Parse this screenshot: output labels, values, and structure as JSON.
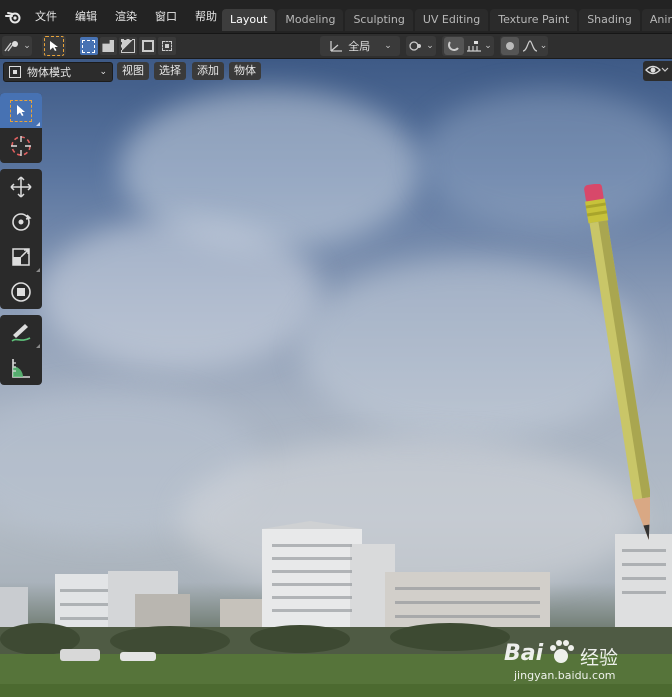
{
  "menu": {
    "items": [
      "文件",
      "编辑",
      "渲染",
      "窗口",
      "帮助"
    ]
  },
  "workspaces": {
    "tabs": [
      {
        "label": "Layout",
        "active": true
      },
      {
        "label": "Modeling",
        "active": false
      },
      {
        "label": "Sculpting",
        "active": false
      },
      {
        "label": "UV Editing",
        "active": false
      },
      {
        "label": "Texture Paint",
        "active": false
      },
      {
        "label": "Shading",
        "active": false
      },
      {
        "label": "Animatio",
        "active": false
      }
    ]
  },
  "tool_header": {
    "orientation_label": "全局"
  },
  "viewport_header": {
    "mode_label": "物体模式",
    "menu_buttons": [
      "视图",
      "选择",
      "添加",
      "物体"
    ]
  },
  "toolbar": {
    "tools": [
      {
        "name": "select-box-tool",
        "active": true
      },
      {
        "name": "cursor-tool",
        "active": false
      },
      {
        "name": "move-tool",
        "active": false
      },
      {
        "name": "rotate-tool",
        "active": false
      },
      {
        "name": "scale-tool",
        "active": false
      },
      {
        "name": "transform-tool",
        "active": false
      },
      {
        "name": "annotate-tool",
        "active": false
      },
      {
        "name": "measure-tool",
        "active": false
      }
    ]
  },
  "watermark": {
    "brand_left": "Bai",
    "brand_right": "经验",
    "url": "jingyan.baidu.com"
  },
  "colors": {
    "accent": "#4772b3",
    "active_select": "#e8a33a",
    "header_bg": "#2f2f2f"
  }
}
